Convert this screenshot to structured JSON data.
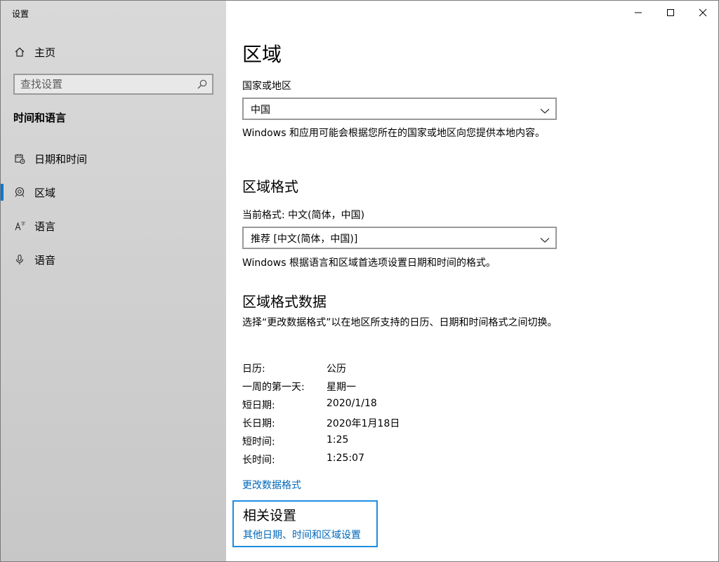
{
  "window": {
    "title": "设置",
    "controls": {
      "minimize": "minimize-icon",
      "maximize": "maximize-icon",
      "close": "close-icon"
    }
  },
  "sidebar": {
    "home_label": "主页",
    "search_placeholder": "查找设置",
    "section_title": "时间和语言",
    "items": [
      {
        "label": "日期和时间",
        "icon": "calendar-clock-icon",
        "selected": false
      },
      {
        "label": "区域",
        "icon": "region-globe-icon",
        "selected": true
      },
      {
        "label": "语言",
        "icon": "language-icon",
        "selected": false
      },
      {
        "label": "语音",
        "icon": "microphone-icon",
        "selected": false
      }
    ],
    "accent_color": "#0078d7"
  },
  "main": {
    "page_title": "区域",
    "country": {
      "label": "国家或地区",
      "value": "中国",
      "description": "Windows 和应用可能会根据您所在的国家或地区向您提供本地内容。"
    },
    "format": {
      "heading": "区域格式",
      "current_label": "当前格式: 中文(简体，中国)",
      "value": "推荐 [中文(简体，中国)]",
      "description": "Windows 根据语言和区域首选项设置日期和时间的格式。"
    },
    "format_data": {
      "heading": "区域格式数据",
      "description": "选择“更改数据格式”以在地区所支持的日历、日期和时间格式之间切换。",
      "rows": [
        {
          "key": "日历:",
          "value": "公历"
        },
        {
          "key": "一周的第一天:",
          "value": "星期一"
        },
        {
          "key": "短日期:",
          "value": "2020/1/18"
        },
        {
          "key": "长日期:",
          "value": "2020年1月18日"
        },
        {
          "key": "短时间:",
          "value": "1:25"
        },
        {
          "key": "长时间:",
          "value": "1:25:07"
        }
      ],
      "change_link": "更改数据格式"
    },
    "related": {
      "heading": "相关设置",
      "link": "其他日期、时间和区域设置"
    },
    "link_color": "#0067b8"
  }
}
